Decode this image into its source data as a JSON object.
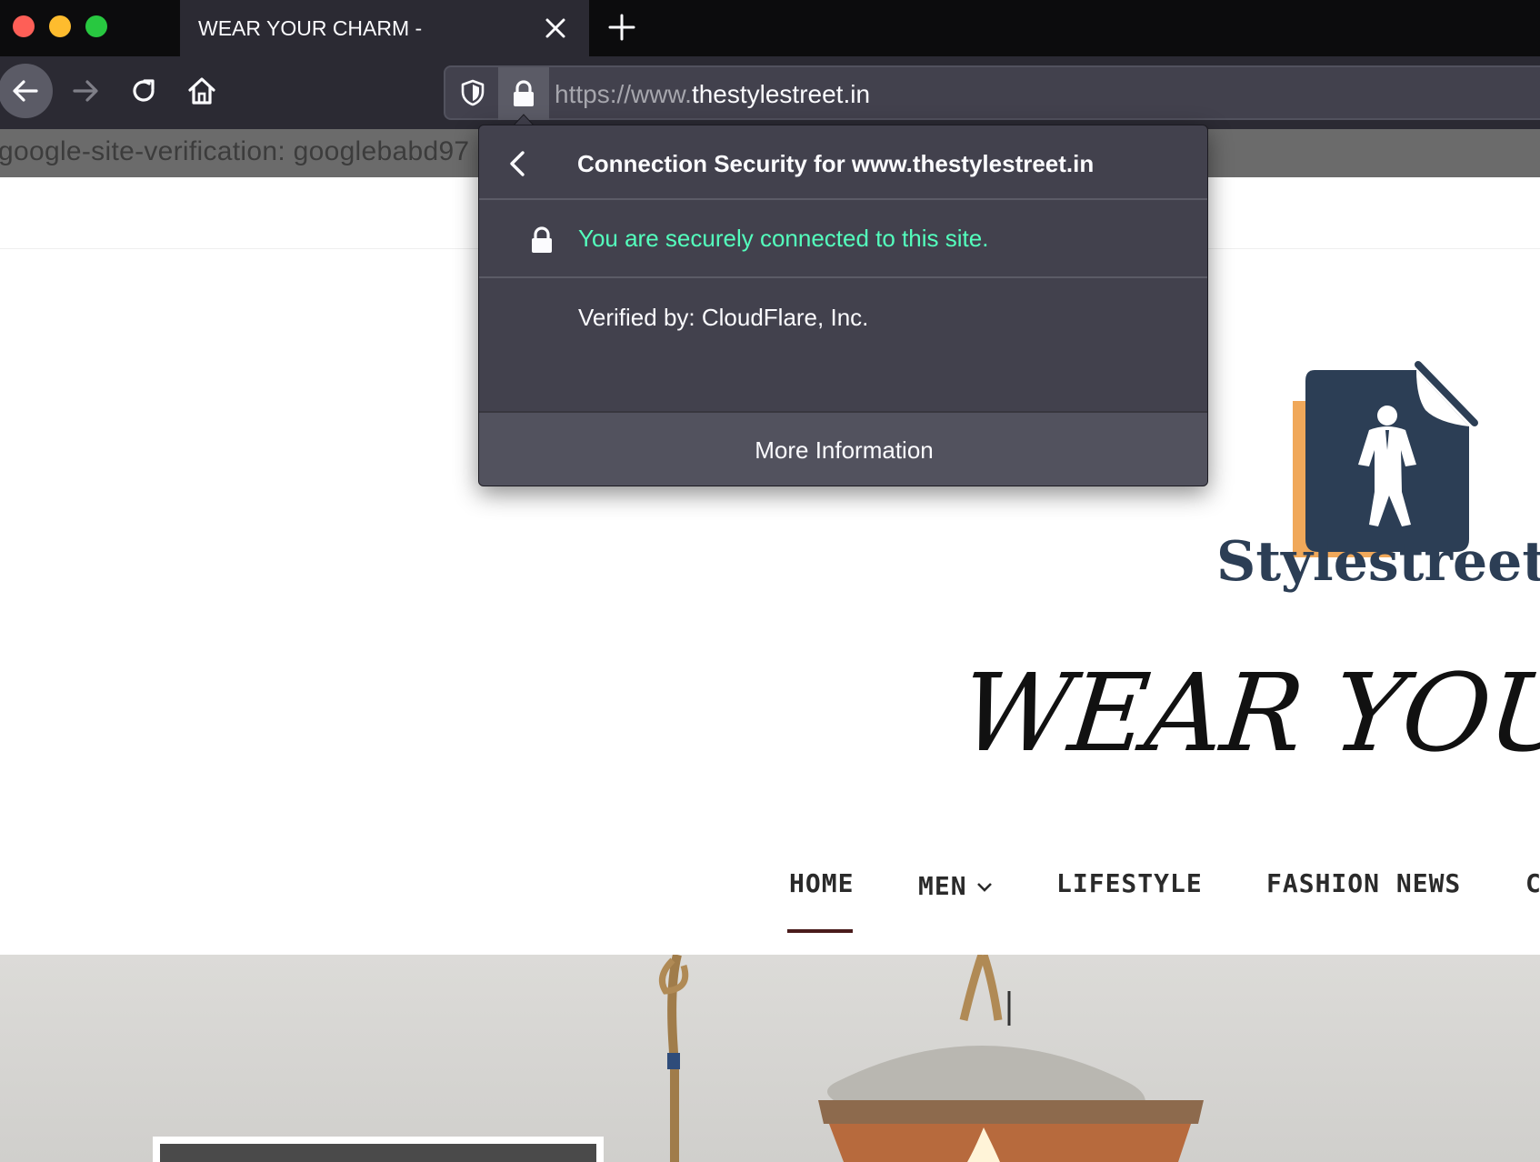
{
  "tab": {
    "title": "WEAR YOUR CHARM -"
  },
  "urlbar": {
    "url_prefix": "https://www.",
    "url_domain": "thestylestreet.in"
  },
  "page_meta": {
    "text": "google-site-verification: googlebabd97"
  },
  "popup": {
    "title": "Connection Security for www.thestylestreet.in",
    "secure_text": "You are securely connected to this site.",
    "verified_text": "Verified by: CloudFlare, Inc.",
    "more_button": "More Information"
  },
  "site": {
    "logo_text": "Stylestreet",
    "slogan": "WEAR YOUR C",
    "nav": {
      "home": "HOME",
      "men": "MEN",
      "lifestyle": "LIFESTYLE",
      "fashion_news": "FASHION NEWS",
      "more": "C"
    }
  },
  "colors": {
    "secure_green": "#54ffbd",
    "popup_bg": "#42414d",
    "toolbar_bg": "#2b2a33",
    "logo_navy": "#2c3e55",
    "logo_orange": "#f0a85a",
    "nav_active": "#4a1c1c"
  },
  "icons": [
    "shield-icon",
    "lock-icon",
    "back-arrow-icon",
    "forward-arrow-icon",
    "reload-icon",
    "home-icon",
    "close-icon",
    "plus-icon",
    "chevron-left-icon",
    "chevron-down-icon"
  ]
}
